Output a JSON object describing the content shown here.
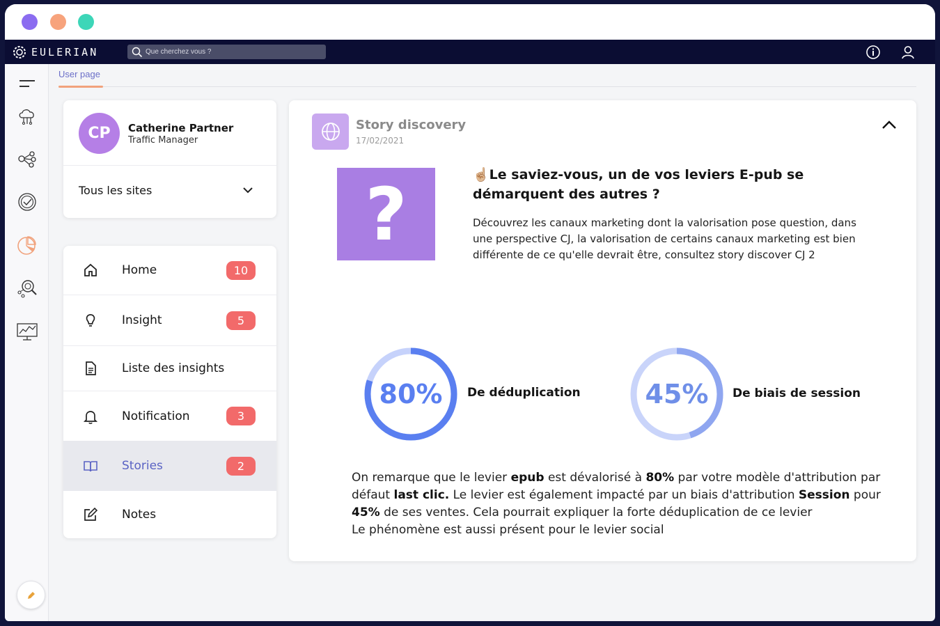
{
  "window": {
    "controls": [
      "close",
      "minimize",
      "maximize"
    ]
  },
  "topbar": {
    "brand": "EULERIAN",
    "search_placeholder": "Que cherchez vous ?"
  },
  "breadcrumb": {
    "label": "User page"
  },
  "profile": {
    "initials": "CP",
    "name": "Catherine Partner",
    "role": "Traffic Manager",
    "site_selector": "Tous les sites"
  },
  "menu": {
    "items": [
      {
        "label": "Home",
        "icon": "home-icon",
        "badge": "10"
      },
      {
        "label": "Insight",
        "icon": "lightbulb-icon",
        "badge": "5"
      },
      {
        "label": "Liste des insights",
        "icon": "document-icon",
        "badge": ""
      },
      {
        "label": "Notification",
        "icon": "bell-icon",
        "badge": "3"
      },
      {
        "label": "Stories",
        "icon": "book-icon",
        "badge": "2",
        "active": true
      },
      {
        "label": "Notes",
        "icon": "edit-icon",
        "badge": ""
      }
    ]
  },
  "story": {
    "title": "Story discovery",
    "date": "17/02/2021",
    "headline_emoji": "☝🏼",
    "headline": "Le saviez-vous, un de vos leviers E-pub se démarquent des autres ?",
    "description": "Découvrez les canaux marketing dont la valorisation pose question, dans une perspective CJ, la valorisation de certains canaux marketing est bien différente de ce qu'elle devrait être, consultez story discover CJ 2",
    "image_glyph": "?",
    "stats": [
      {
        "value": "80%",
        "fraction": 0.8,
        "label": "De déduplication",
        "color": "#5a7ff0"
      },
      {
        "value": "45%",
        "fraction": 0.45,
        "label": "De biais de session",
        "color": "#6f8fe8"
      }
    ],
    "summary": {
      "p1": "On remarque que le levier ",
      "b1": "epub",
      "p2": " est dévalorisé à ",
      "b2": "80%",
      "p3": " par votre modèle d'attribution par défaut ",
      "b3": "last clic.",
      "p4": " Le levier est également impacté par un biais d'attribution ",
      "b4": "Session",
      "p5": " pour ",
      "b5": "45%",
      "p6": " de ses ventes. Cela pourrait expliquer la forte déduplication de ce levier",
      "line2": "Le phénomène est aussi présent pour le levier social"
    }
  },
  "colors": {
    "nav_bg": "#0b0d33",
    "accent": "#5a63c4",
    "badge": "#f26a6a",
    "avatar": "#b57fe6"
  }
}
